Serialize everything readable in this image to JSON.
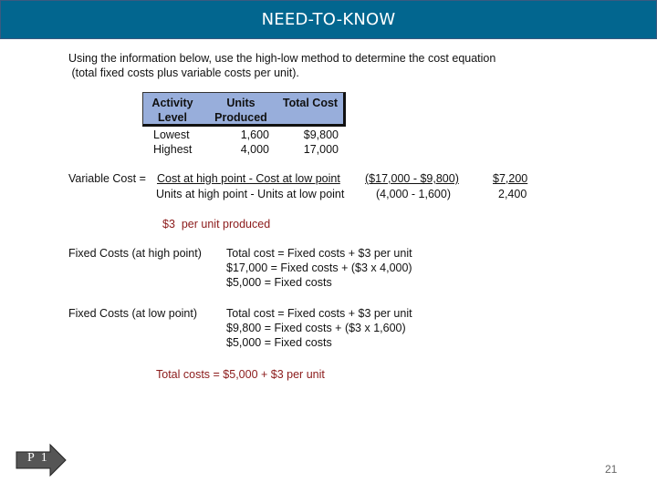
{
  "header": {
    "title": "NEED-TO-KNOW",
    "background_color": "#02668f"
  },
  "intro": {
    "line1": "Using the information below, use the high-low method to determine the cost equation",
    "line2": " (total fixed costs plus variable costs per unit)."
  },
  "table": {
    "header_color": "#98aedb",
    "columns": [
      {
        "line1": "Activity",
        "line2": "Level"
      },
      {
        "line1": "Units",
        "line2": "Produced"
      },
      {
        "line1": "Total Cost",
        "line2": ""
      }
    ],
    "rows": [
      {
        "level": "Lowest",
        "units": "1,600",
        "cost": "$9,800"
      },
      {
        "level": "Highest",
        "units": "4,000",
        "cost": "17,000"
      }
    ]
  },
  "variable_cost": {
    "label": "Variable Cost =",
    "formula_numerator": "Cost at high point - Cost at low point",
    "formula_denominator": "Units at high point - Units at low point",
    "values_numerator": "($17,000 - $9,800)",
    "values_denominator": "(4,000 - 1,600)",
    "result_numerator": "$7,200",
    "result_denominator": "2,400",
    "result": "$3  per unit produced"
  },
  "fixed_costs": [
    {
      "label": "Fixed Costs (at high point)",
      "lines": [
        "Total cost = Fixed costs + $3 per unit",
        "$17,000 = Fixed costs + ($3 x 4,000)",
        "$5,000 = Fixed costs"
      ]
    },
    {
      "label": "Fixed Costs (at low point)",
      "lines": [
        "Total cost = Fixed costs + $3 per unit",
        "$9,800 = Fixed costs + ($3 x 1,600)",
        "$5,000 = Fixed costs"
      ]
    }
  ],
  "total_costs": "Total costs = $5,000 + $3 per unit",
  "accent_text_color": "#8b1a1a",
  "nav": {
    "arrow_label": "P 1"
  },
  "page_number": "21"
}
